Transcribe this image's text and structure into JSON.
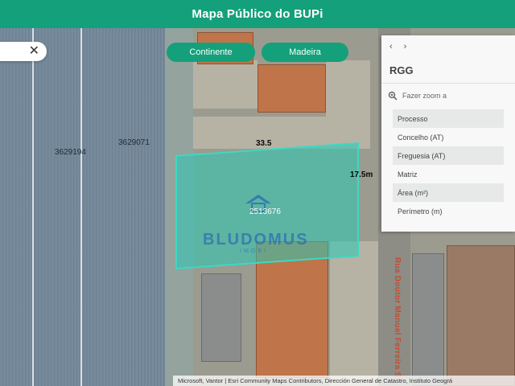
{
  "header": {
    "title": "Mapa Público do BUPi"
  },
  "search": {
    "close_symbol": "✕"
  },
  "region_buttons": {
    "continente": "Continente",
    "madeira": "Madeira"
  },
  "map": {
    "parcel_labels": [
      "3629194",
      "3629071"
    ],
    "selected_parcel_id": "2513676",
    "dimension_top": "33.5",
    "dimension_side": "17.5m",
    "street_name": "Rua Doutor Manuel Ferreira S",
    "watermark": "BLUDOMUS",
    "watermark_sub": "IMOBI"
  },
  "panel": {
    "nav_back": "‹",
    "nav_forward": "›",
    "title": "RGG",
    "zoom_label": "Fazer zoom a",
    "rows": [
      "Processo",
      "Concelho (AT)",
      "Freguesia (AT)",
      "Matriz",
      "Área (m²)",
      "Perímetro (m)"
    ]
  },
  "attribution": "Microsoft, Vantor | Esri Community Maps Contributors, Dirección General de Catastro, Instituto Geográ",
  "colors": {
    "brand": "#14a07a",
    "highlight": "#3ed8c4"
  }
}
